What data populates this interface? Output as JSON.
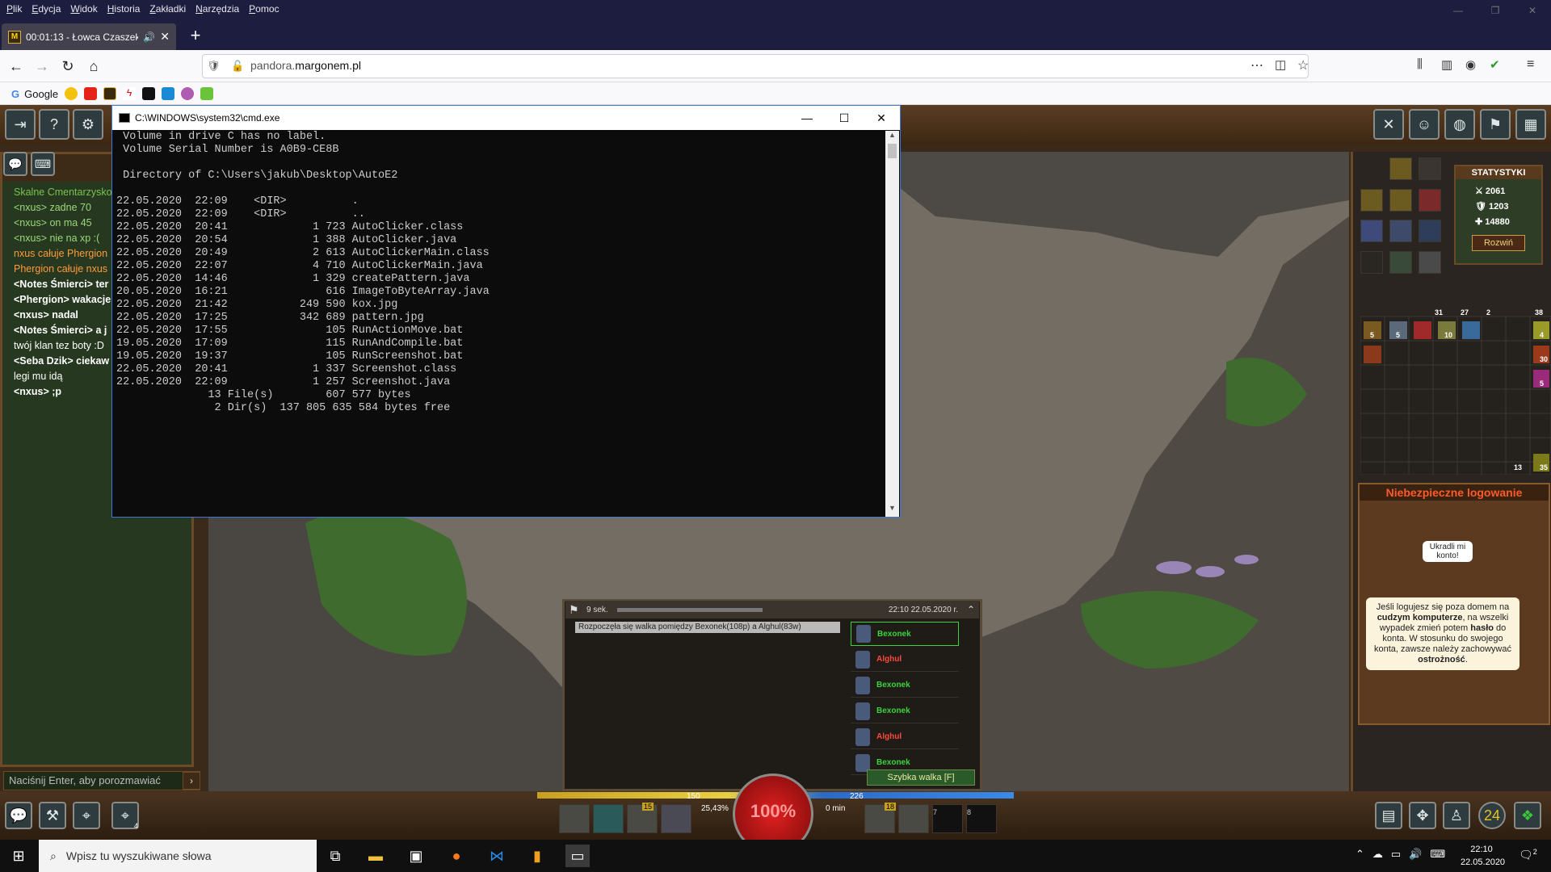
{
  "menubar": [
    "Plik",
    "Edycja",
    "Widok",
    "Historia",
    "Zakładki",
    "Narzędzia",
    "Pomoc"
  ],
  "tab": {
    "title": "00:01:13 - Łowca Czaszek"
  },
  "url": {
    "prefix": "pandora.",
    "domain": "margonem.pl"
  },
  "bookmarks": {
    "google": "Google"
  },
  "cmd": {
    "title": "C:\\WINDOWS\\system32\\cmd.exe",
    "lines": [
      " Volume in drive C has no label.",
      " Volume Serial Number is A0B9-CE8B",
      "",
      " Directory of C:\\Users\\jakub\\Desktop\\AutoE2",
      "",
      "22.05.2020  22:09    <DIR>          .",
      "22.05.2020  22:09    <DIR>          ..",
      "22.05.2020  20:41             1 723 AutoClicker.class",
      "22.05.2020  20:54             1 388 AutoClicker.java",
      "22.05.2020  20:49             2 613 AutoClickerMain.class",
      "22.05.2020  22:07             4 710 AutoClickerMain.java",
      "22.05.2020  14:46             1 329 createPattern.java",
      "20.05.2020  16:21               616 ImageToByteArray.java",
      "22.05.2020  21:42           249 590 kox.jpg",
      "22.05.2020  17:25           342 689 pattern.jpg",
      "22.05.2020  17:55               105 RunActionMove.bat",
      "19.05.2020  17:09               115 RunAndCompile.bat",
      "19.05.2020  19:37               105 RunScreenshot.bat",
      "22.05.2020  20:41             1 337 Screenshot.class",
      "22.05.2020  22:09             1 257 Screenshot.java",
      "              13 File(s)        607 577 bytes",
      "               2 Dir(s)  137 805 635 584 bytes free"
    ]
  },
  "chat": {
    "location": "Skalne Cmentarzysko",
    "messages": [
      {
        "text": "<nxus> zadne 70",
        "color": "#9bd87a",
        "bold": false
      },
      {
        "text": "<nxus> on ma 45",
        "color": "#9bd87a",
        "bold": false
      },
      {
        "text": "<nxus> nie na xp :(",
        "color": "#9bd87a",
        "bold": false
      },
      {
        "text": "nxus całuje Phergion",
        "color": "#ff9a3c",
        "bold": false
      },
      {
        "text": "Phergion całuje nxus",
        "color": "#ff9a3c",
        "bold": false
      },
      {
        "text": "<Notes Śmierci> ter",
        "color": "#ffffff",
        "bold": true
      },
      {
        "text": "<Phergion> wakacje",
        "color": "#ffffff",
        "bold": true
      },
      {
        "text": "<nxus> nadal",
        "color": "#ffffff",
        "bold": true
      },
      {
        "text": "<Notes Śmierci> a j",
        "color": "#ffffff",
        "bold": true
      },
      {
        "text": "twój klan tez boty :D",
        "color": "#ffffff",
        "bold": false
      },
      {
        "text": "<Seba Dzik> ciekaw",
        "color": "#ffffff",
        "bold": true
      },
      {
        "text": "legi mu idą",
        "color": "#ffffff",
        "bold": false
      },
      {
        "text": "<nxus> ;p",
        "color": "#ffffff",
        "bold": true
      }
    ],
    "input_placeholder": "Naciśnij Enter, aby porozmawiać"
  },
  "stats": {
    "header": "STATYSTYKI",
    "values": [
      "2061",
      "1203",
      "14880"
    ],
    "expand": "Rozwiń"
  },
  "inventory_counts": [
    "31",
    "27",
    "2",
    "38",
    "5",
    "5",
    "10",
    "4",
    "30",
    "5",
    "13",
    "35"
  ],
  "ad": {
    "title": "Niebezpieczne logowanie",
    "bubble": "Ukradli mi konto!",
    "text_parts": [
      "Jeśli logujesz się poza domem na ",
      "cudzym komputerze",
      ", na wszelki wypadek zmień potem ",
      "hasło",
      " do konta. W stosunku do swojego konta, zawsze należy zachowywać ",
      "ostrożność",
      "."
    ]
  },
  "fight": {
    "timer": "9 sek.",
    "datetime": "22:10 22.05.2020 r.",
    "log": "Rozpoczęła się walka pomiędzy Bexonek(108p) a Alghul(83w)",
    "fighters": [
      {
        "name": "Bexonek",
        "color": "#3cd43c"
      },
      {
        "name": "Alghul",
        "color": "#ff4a3a"
      },
      {
        "name": "Bexonek",
        "color": "#3cd43c"
      },
      {
        "name": "Bexonek",
        "color": "#3cd43c"
      },
      {
        "name": "Alghul",
        "color": "#ff4a3a"
      },
      {
        "name": "Bexonek",
        "color": "#3cd43c"
      }
    ],
    "quick_fight": "Szybka walka [F]"
  },
  "hud": {
    "health": "100%",
    "hp_left": "150",
    "hp_right": "226",
    "exp": "25,43%",
    "time": "0 min",
    "skill_badges": [
      "15",
      "18"
    ],
    "slot_numbers": [
      "7",
      "8"
    ],
    "map_number": "4"
  },
  "taskbar": {
    "search_placeholder": "Wpisz tu wyszukiwane słowa",
    "time": "22:10",
    "date": "22.05.2020",
    "notif": "2"
  }
}
